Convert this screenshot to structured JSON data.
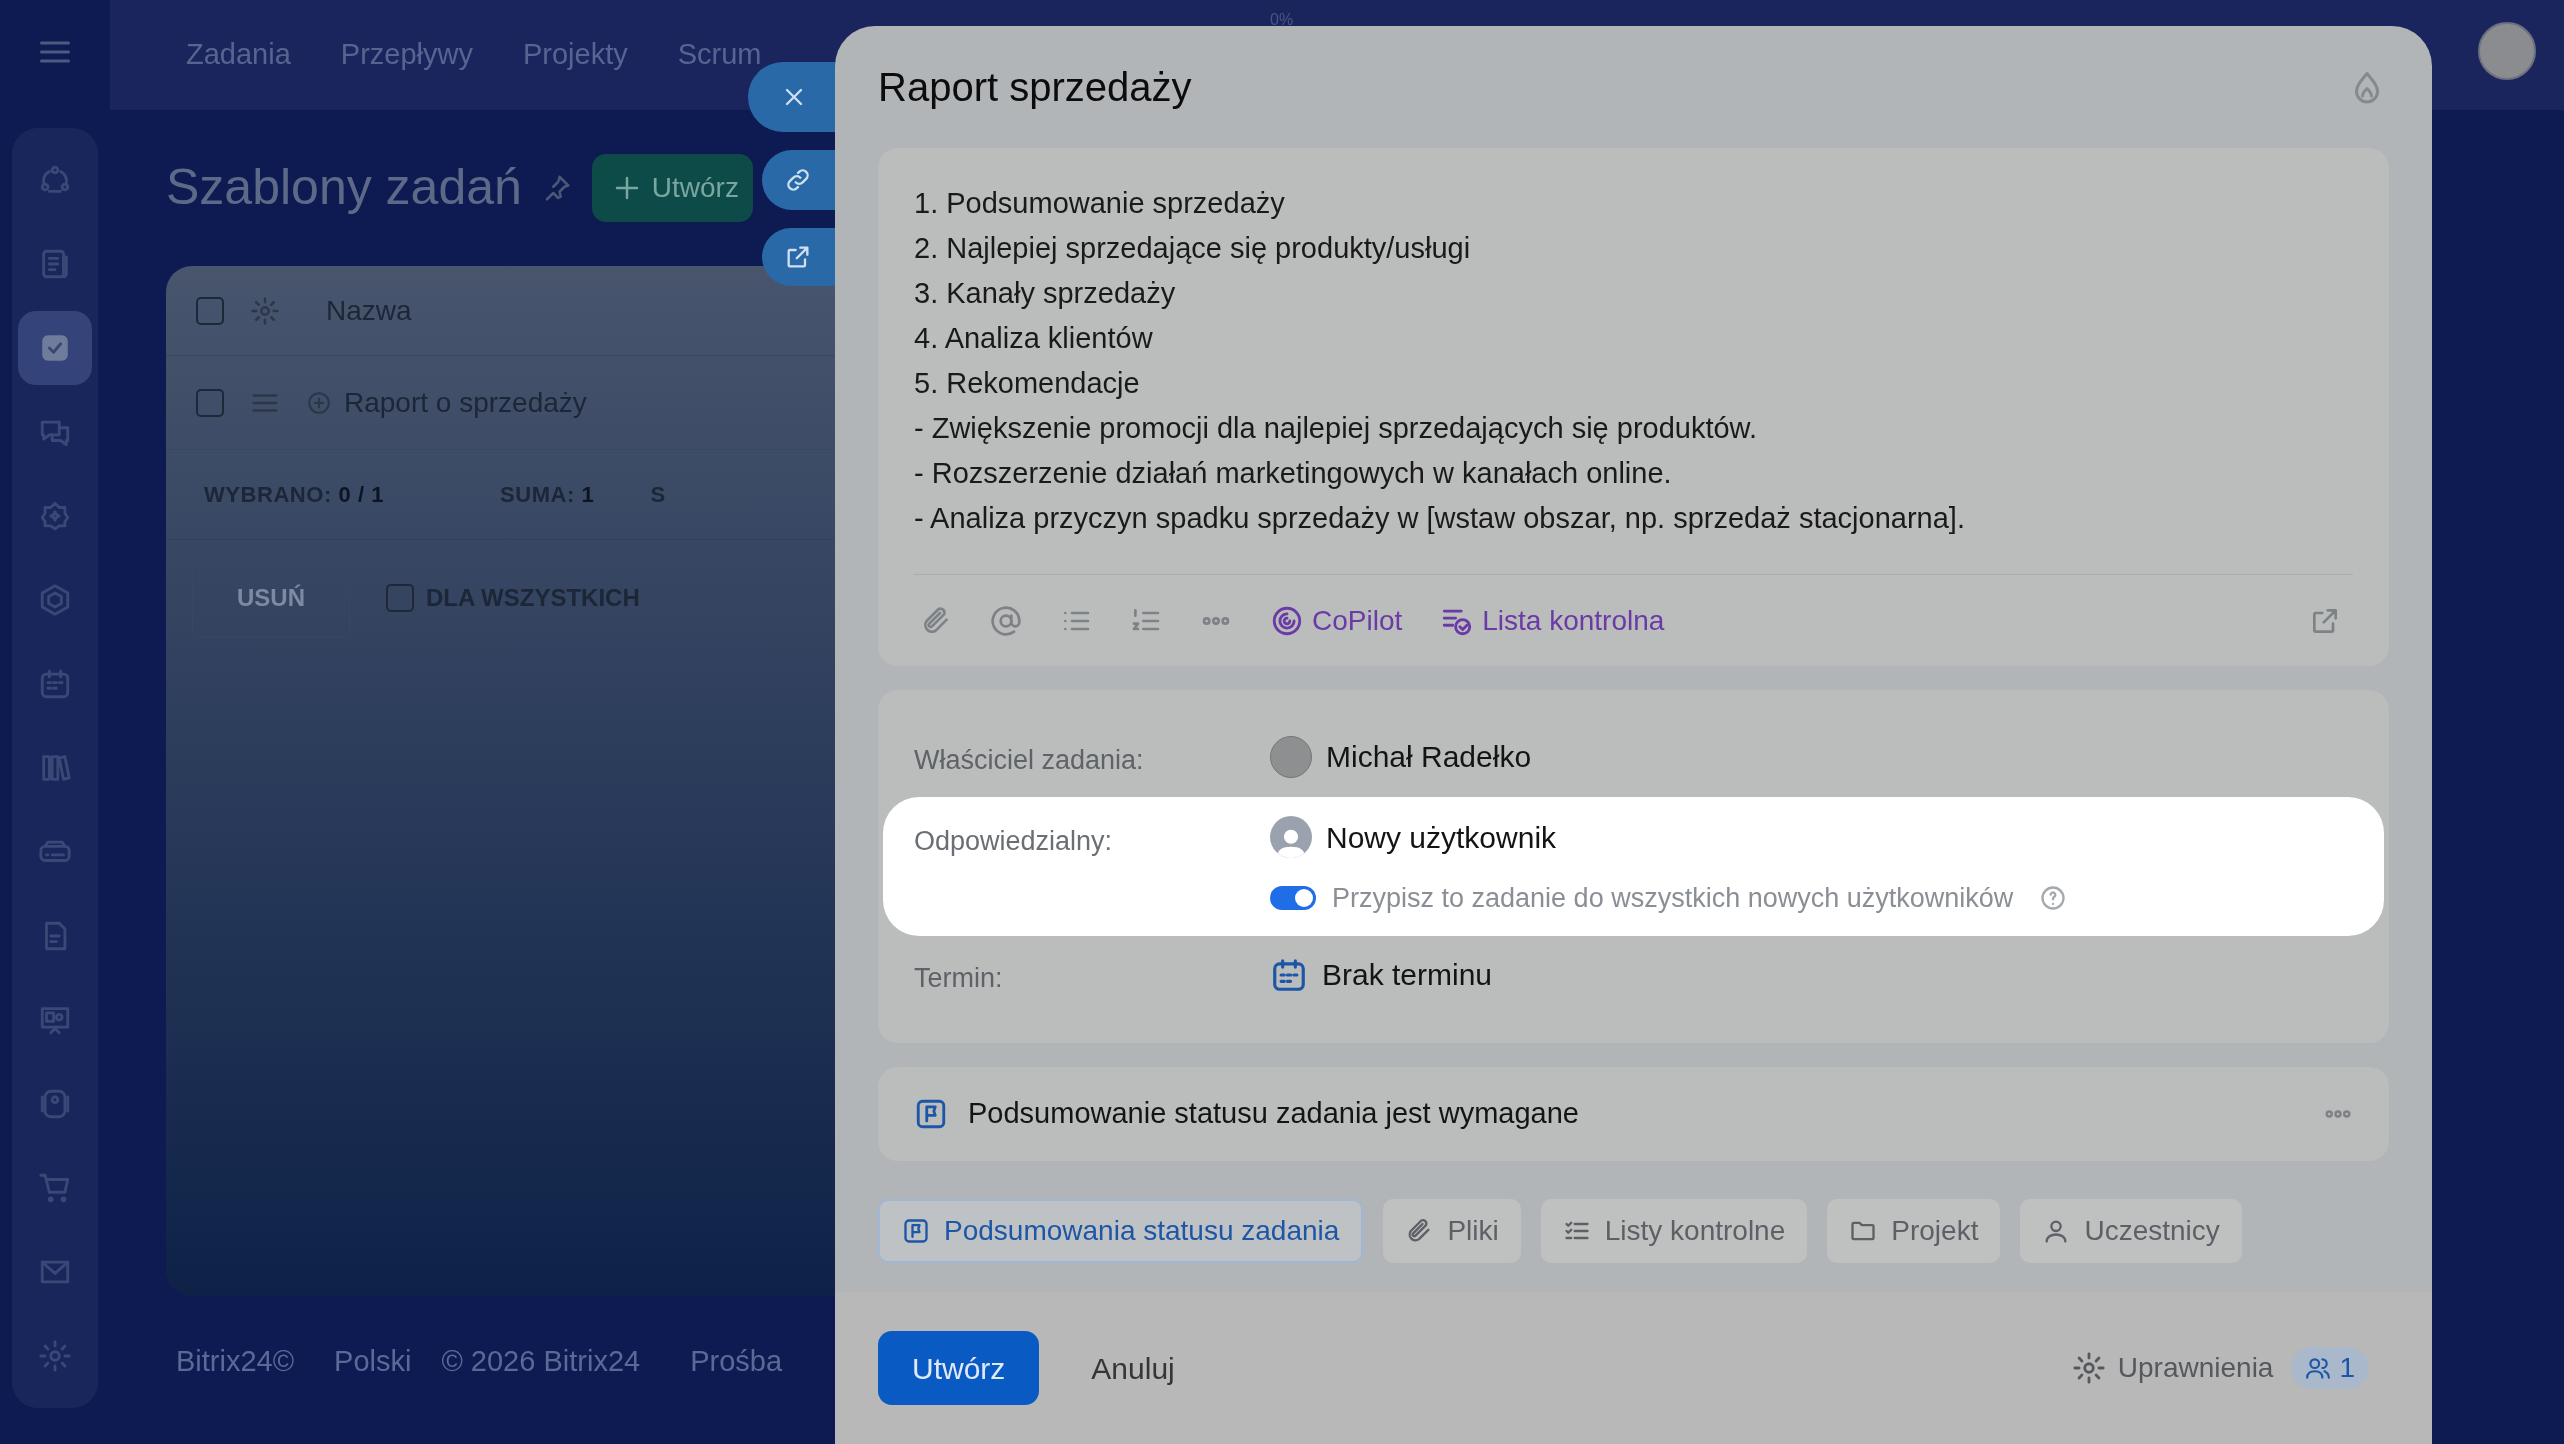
{
  "top_nav": {
    "items": [
      "Zadania",
      "Przepływy",
      "Projekty",
      "Scrum"
    ],
    "progress_label": "0%"
  },
  "sidebar": {
    "items": [
      {
        "selected": false
      },
      {
        "selected": false
      },
      {
        "selected": true
      },
      {
        "selected": false
      },
      {
        "selected": false
      },
      {
        "selected": false
      },
      {
        "selected": false
      },
      {
        "selected": false
      },
      {
        "selected": false
      },
      {
        "selected": false
      },
      {
        "selected": false
      },
      {
        "selected": false
      },
      {
        "selected": false
      },
      {
        "selected": false
      },
      {
        "selected": false
      }
    ]
  },
  "page": {
    "title": "Szablony zadań",
    "create_button": "Utwórz"
  },
  "table": {
    "header": "Nazwa",
    "header_checked": false,
    "rows": [
      {
        "name": "Raport o sprzedaży",
        "checked": false
      }
    ],
    "summary": [
      {
        "label": "WYBRANO:",
        "value": "0 / 1"
      },
      {
        "label": "SUMA:",
        "value": "1"
      }
    ],
    "column_3": "S",
    "delete_button": "USUŃ",
    "for_all": {
      "label": "DLA WSZYSTKICH",
      "checked": false
    }
  },
  "footer": {
    "brand": "Bitrix24©",
    "language": "Polski",
    "copyright": "© 2026 Bitrix24",
    "link": "Prośba"
  },
  "modal": {
    "title": "Raport sprzedaży",
    "description": [
      "1. Podsumowanie sprzedaży",
      "2. Najlepiej sprzedające się produkty/usługi",
      "3. Kanały sprzedaży",
      "4. Analiza klientów",
      "5. Rekomendacje",
      "- Zwiększenie promocji dla najlepiej sprzedających się produktów.",
      "- Rozszerzenie działań marketingowych w kanałach online.",
      "- Analiza przyczyn spadku sprzedaży w [wstaw obszar, np. sprzedaż stacjonarna]."
    ],
    "toolbar": {
      "copilot": "CoPilot",
      "checklist": "Lista kontrolna"
    },
    "fields": [
      {
        "kind": "user",
        "label": "Właściciel zadania:",
        "value": "Michał Radełko",
        "highlighted": false
      },
      {
        "kind": "user-empty",
        "label": "Odpowiedzialny:",
        "value": "Nowy użytkownik",
        "highlighted": true,
        "toggle": {
          "label": "Przypisz to zadanie do wszystkich nowych użytkowników",
          "on": true
        }
      },
      {
        "kind": "date",
        "label": "Termin:",
        "value": "Brak terminu",
        "highlighted": false
      }
    ],
    "required_banner": "Podsumowanie statusu zadania jest wymagane",
    "tabs": [
      {
        "kind": "flag",
        "label": "Podsumowania statusu zadania",
        "selected": true
      },
      {
        "kind": "clip",
        "label": "Pliki",
        "selected": false
      },
      {
        "kind": "list",
        "label": "Listy kontrolne",
        "selected": false
      },
      {
        "kind": "folder",
        "label": "Projekt",
        "selected": false
      },
      {
        "kind": "person",
        "label": "Uczestnicy",
        "selected": false
      }
    ],
    "create_button": "Utwórz",
    "cancel_button": "Anuluj",
    "permissions": "Uprawnienia",
    "participants_count": "1"
  }
}
